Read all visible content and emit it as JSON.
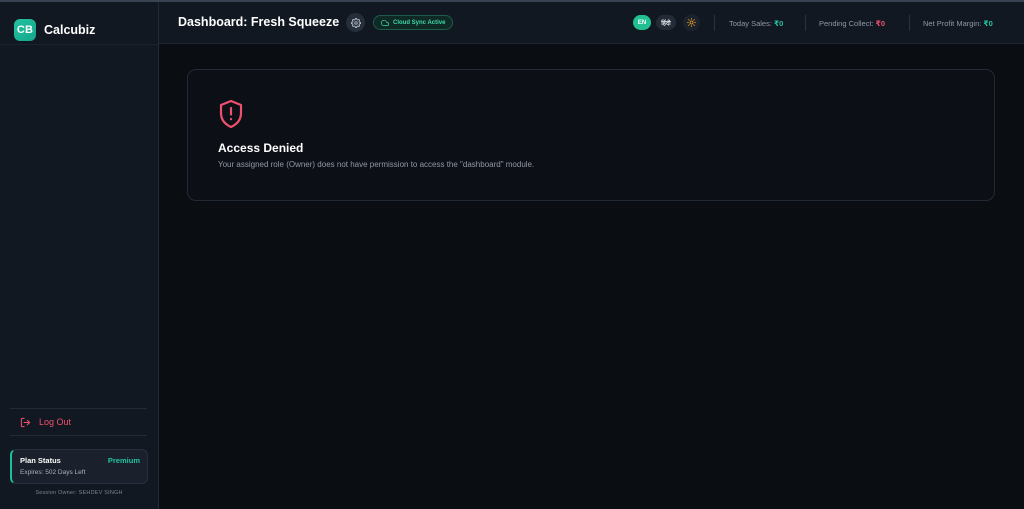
{
  "brand": {
    "logo_text": "CB",
    "name": "Calcubiz"
  },
  "header": {
    "title": "Dashboard: Fresh Squeeze",
    "sync_status": "Cloud Sync Active",
    "lang_en": "EN",
    "lang_hi": "हिंदी",
    "stats": [
      {
        "label": "Today Sales:",
        "value": "₹0",
        "color": "#22c3a2"
      },
      {
        "label": "Pending Collect:",
        "value": "₹0",
        "color": "#f0506e"
      },
      {
        "label": "Net Profit Margin:",
        "value": "₹0",
        "color": "#22c3a2"
      }
    ]
  },
  "sidebar": {
    "logout_label": "Log Out",
    "plan": {
      "title": "Plan Status",
      "tier": "Premium",
      "expiry": "Expires: 502 Days Left"
    },
    "session_owner": "Session Owner: SEHDEV SINGH"
  },
  "main": {
    "card": {
      "title": "Access Denied",
      "message": "Your assigned role (Owner) does not have permission to access the \"dashboard\" module."
    }
  },
  "colors": {
    "accent": "#22c3a2",
    "danger": "#f0506e",
    "background": "#0a0d12",
    "panel": "#121821"
  },
  "icons": {
    "settings": "gear-icon",
    "sync": "cloud-icon",
    "theme": "sun-icon",
    "logout": "logout-icon",
    "denied": "shield-alert-icon"
  }
}
